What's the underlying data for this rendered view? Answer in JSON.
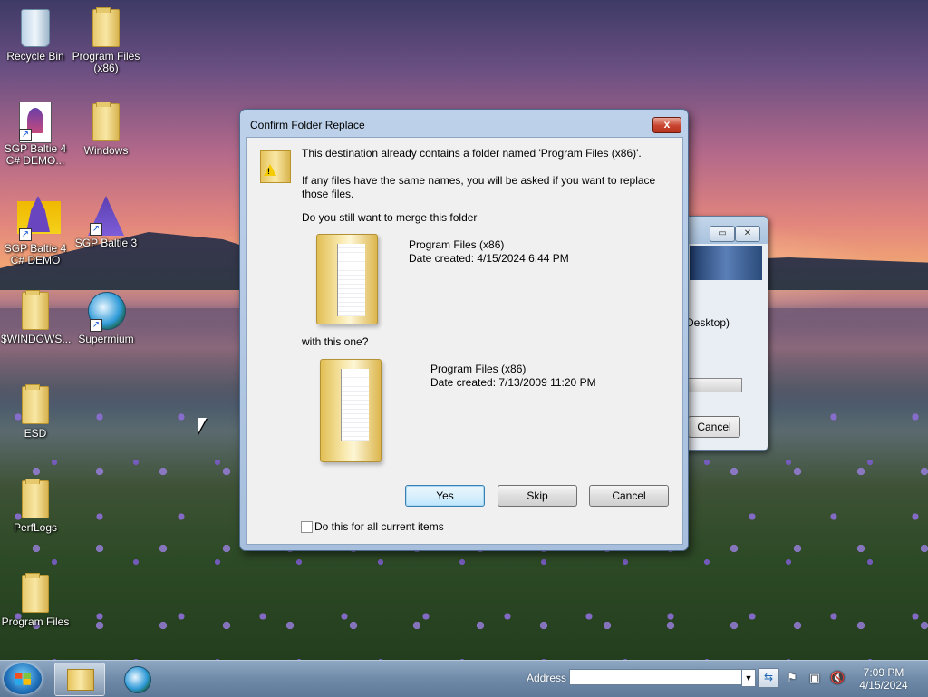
{
  "desktop": {
    "icons": [
      {
        "label": "Recycle Bin"
      },
      {
        "label": "Program Files (x86)"
      },
      {
        "label": "SGP Baltie 4 C# DEMO..."
      },
      {
        "label": "Windows"
      },
      {
        "label": "SGP Baltie 4 C# DEMO"
      },
      {
        "label": "SGP Baltie 3"
      },
      {
        "label": "$WINDOWS..."
      },
      {
        "label": "Supermium"
      },
      {
        "label": "ESD"
      },
      {
        "label": "PerfLogs"
      },
      {
        "label": "Program Files"
      }
    ]
  },
  "background_window": {
    "path_fragment": "Desktop)",
    "cancel_label": "Cancel"
  },
  "dialog": {
    "title": "Confirm Folder Replace",
    "close_label": "x",
    "message_line1": "This destination already contains a folder named 'Program Files (x86)'.",
    "message_line2": "If any files have the same names, you will be asked if you want to replace those files.",
    "question": "Do you still want to merge this folder",
    "source": {
      "name": "Program Files (x86)",
      "date": "Date created: 4/15/2024 6:44 PM"
    },
    "with_text": "with this one?",
    "destination": {
      "name": "Program Files (x86)",
      "date": "Date created: 7/13/2009 11:20 PM"
    },
    "buttons": {
      "yes": "Yes",
      "skip": "Skip",
      "cancel": "Cancel"
    },
    "checkbox_label": "Do this for all current items"
  },
  "taskbar": {
    "address_label": "Address",
    "address_value": "",
    "clock_time": "7:09 PM",
    "clock_date": "4/15/2024"
  }
}
